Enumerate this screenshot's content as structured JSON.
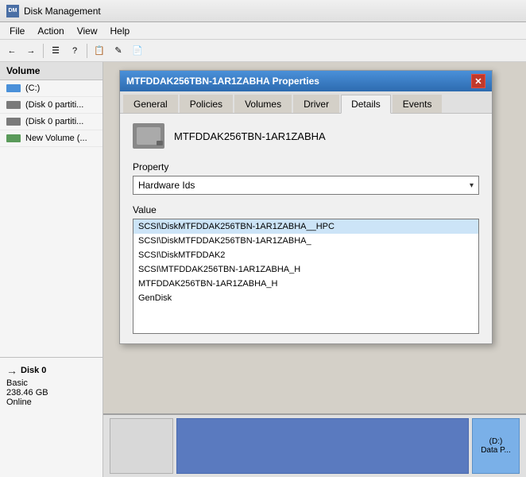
{
  "window": {
    "title": "Disk Management",
    "icon_label": "DM"
  },
  "menu": {
    "items": [
      "File",
      "Action",
      "View",
      "Help"
    ]
  },
  "toolbar": {
    "buttons": [
      "←",
      "→",
      "☰",
      "?",
      "📋",
      "✎",
      "📄"
    ]
  },
  "sidebar": {
    "header": "Volume",
    "items": [
      {
        "label": "(C:)",
        "type": "c-drive"
      },
      {
        "label": "(Disk 0 partiti...",
        "type": "partition"
      },
      {
        "label": "(Disk 0 partiti...",
        "type": "partition"
      },
      {
        "label": "New Volume (...",
        "type": "new-vol"
      }
    ]
  },
  "dialog": {
    "title": "MTFDDAK256TBN-1AR1ZABHA Properties",
    "close_btn": "✕",
    "tabs": [
      {
        "label": "General",
        "active": false
      },
      {
        "label": "Policies",
        "active": false
      },
      {
        "label": "Volumes",
        "active": false
      },
      {
        "label": "Driver",
        "active": false
      },
      {
        "label": "Details",
        "active": true
      },
      {
        "label": "Events",
        "active": false
      }
    ],
    "device_name": "MTFDDAK256TBN-1AR1ZABHA",
    "property_label": "Property",
    "property_value": "Hardware Ids",
    "value_label": "Value",
    "value_items": [
      {
        "text": "SCSI\\DiskMTFDDAK256TBN-1AR1ZABHA__HPC",
        "selected": true
      },
      {
        "text": "SCSI\\DiskMTFDDAK256TBN-1AR1ZABHA_",
        "selected": false
      },
      {
        "text": "SCSI\\DiskMTFDDAK2",
        "selected": false
      },
      {
        "text": "SCSI\\MTFDDAK256TBN-1AR1ZABHA_H",
        "selected": false
      },
      {
        "text": "MTFDDAK256TBN-1AR1ZABHA_H",
        "selected": false
      },
      {
        "text": "GenDisk",
        "selected": false
      }
    ]
  },
  "disk_info": {
    "label": "Disk 0",
    "type": "Basic",
    "size": "238.46 GB",
    "status": "Online",
    "arrow": "→"
  },
  "bottom_panel": {
    "d_drive_label": "(D:)",
    "data_label": "Data P..."
  }
}
